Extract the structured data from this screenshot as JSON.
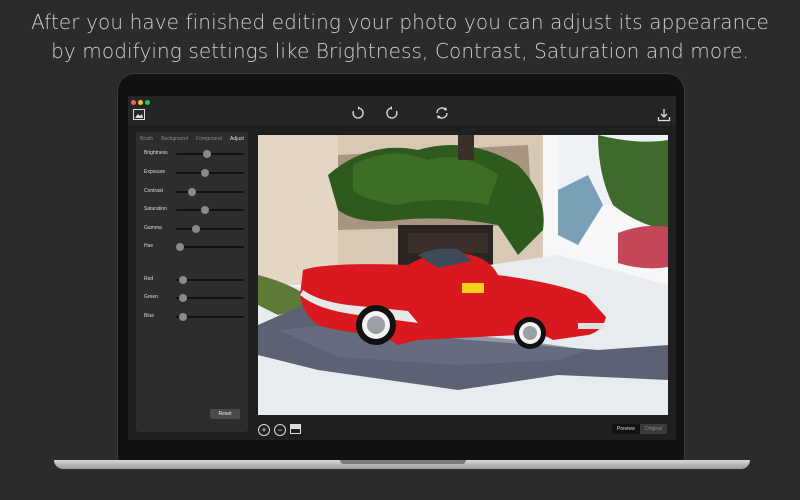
{
  "headline": {
    "line1": "After you have finished editing your photo you can adjust its appearance",
    "line2": "by modifying settings like Brightness, Contrast, Saturation and more."
  },
  "toolbar": {
    "undo_icon": "undo-icon",
    "redo_icon": "redo-icon",
    "refresh_icon": "refresh-icon",
    "export_icon": "download-icon",
    "photo_icon": "image-icon"
  },
  "tabs": [
    "Brush",
    "Background",
    "Foreground",
    "Adjust"
  ],
  "active_tab": "Adjust",
  "sliders": [
    {
      "label": "Brightness",
      "value": 0.45
    },
    {
      "label": "Exposure",
      "value": 0.43
    },
    {
      "label": "Contrast",
      "value": 0.23
    },
    {
      "label": "Saturation",
      "value": 0.43
    },
    {
      "label": "Gamma",
      "value": 0.3
    },
    {
      "label": "Hue",
      "value": 0.0
    },
    {
      "label": "Red",
      "value": 0.1
    },
    {
      "label": "Green",
      "value": 0.1
    },
    {
      "label": "Blue",
      "value": 0.1
    }
  ],
  "reset_label": "Reset",
  "view_modes": {
    "preview": "Preview",
    "original": "Original",
    "selected": "Preview"
  },
  "colors": {
    "car_red": "#d91820",
    "wall": "#d9c8b5",
    "ivy": "#2f5a1e",
    "road": "#5c6173",
    "background": "#2b2b2b"
  }
}
